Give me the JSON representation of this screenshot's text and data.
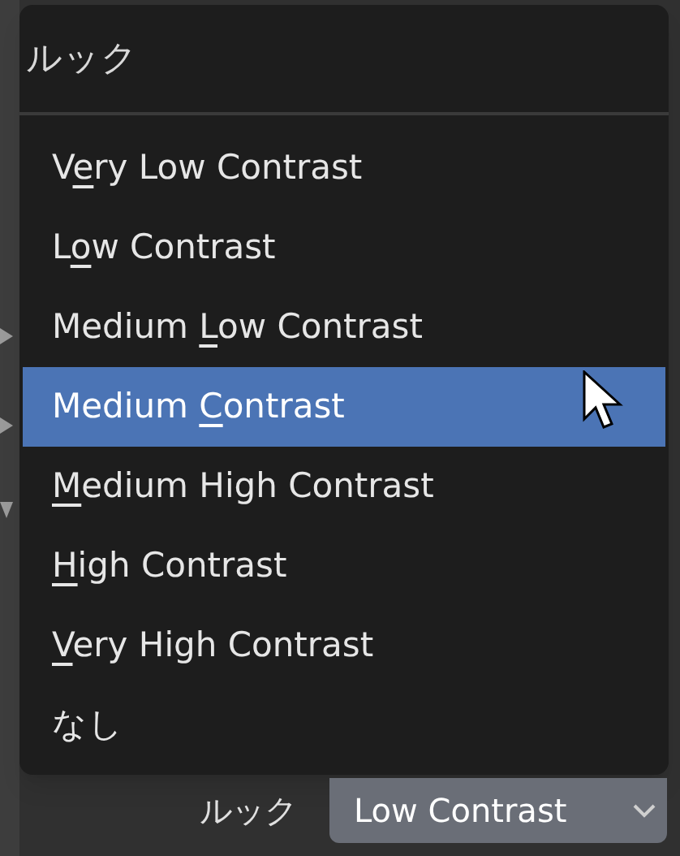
{
  "menu": {
    "title": "ルック",
    "items": [
      {
        "before": "V",
        "key": "e",
        "after": "ry Low Contrast",
        "selected": false
      },
      {
        "before": "L",
        "key": "o",
        "after": "w Contrast",
        "selected": false
      },
      {
        "before": "Medium ",
        "key": "L",
        "after": "ow Contrast",
        "selected": false
      },
      {
        "before": "Medium ",
        "key": "C",
        "after": "ontrast",
        "selected": true
      },
      {
        "key": "M",
        "after": "edium High Contrast",
        "selected": false
      },
      {
        "key": "H",
        "after": "igh Contrast",
        "selected": false
      },
      {
        "key": "V",
        "after": "ery High Contrast",
        "selected": false
      },
      {
        "before": "なし",
        "selected": false
      }
    ]
  },
  "look_field": {
    "label": "ルック",
    "value": "Low Contrast"
  }
}
